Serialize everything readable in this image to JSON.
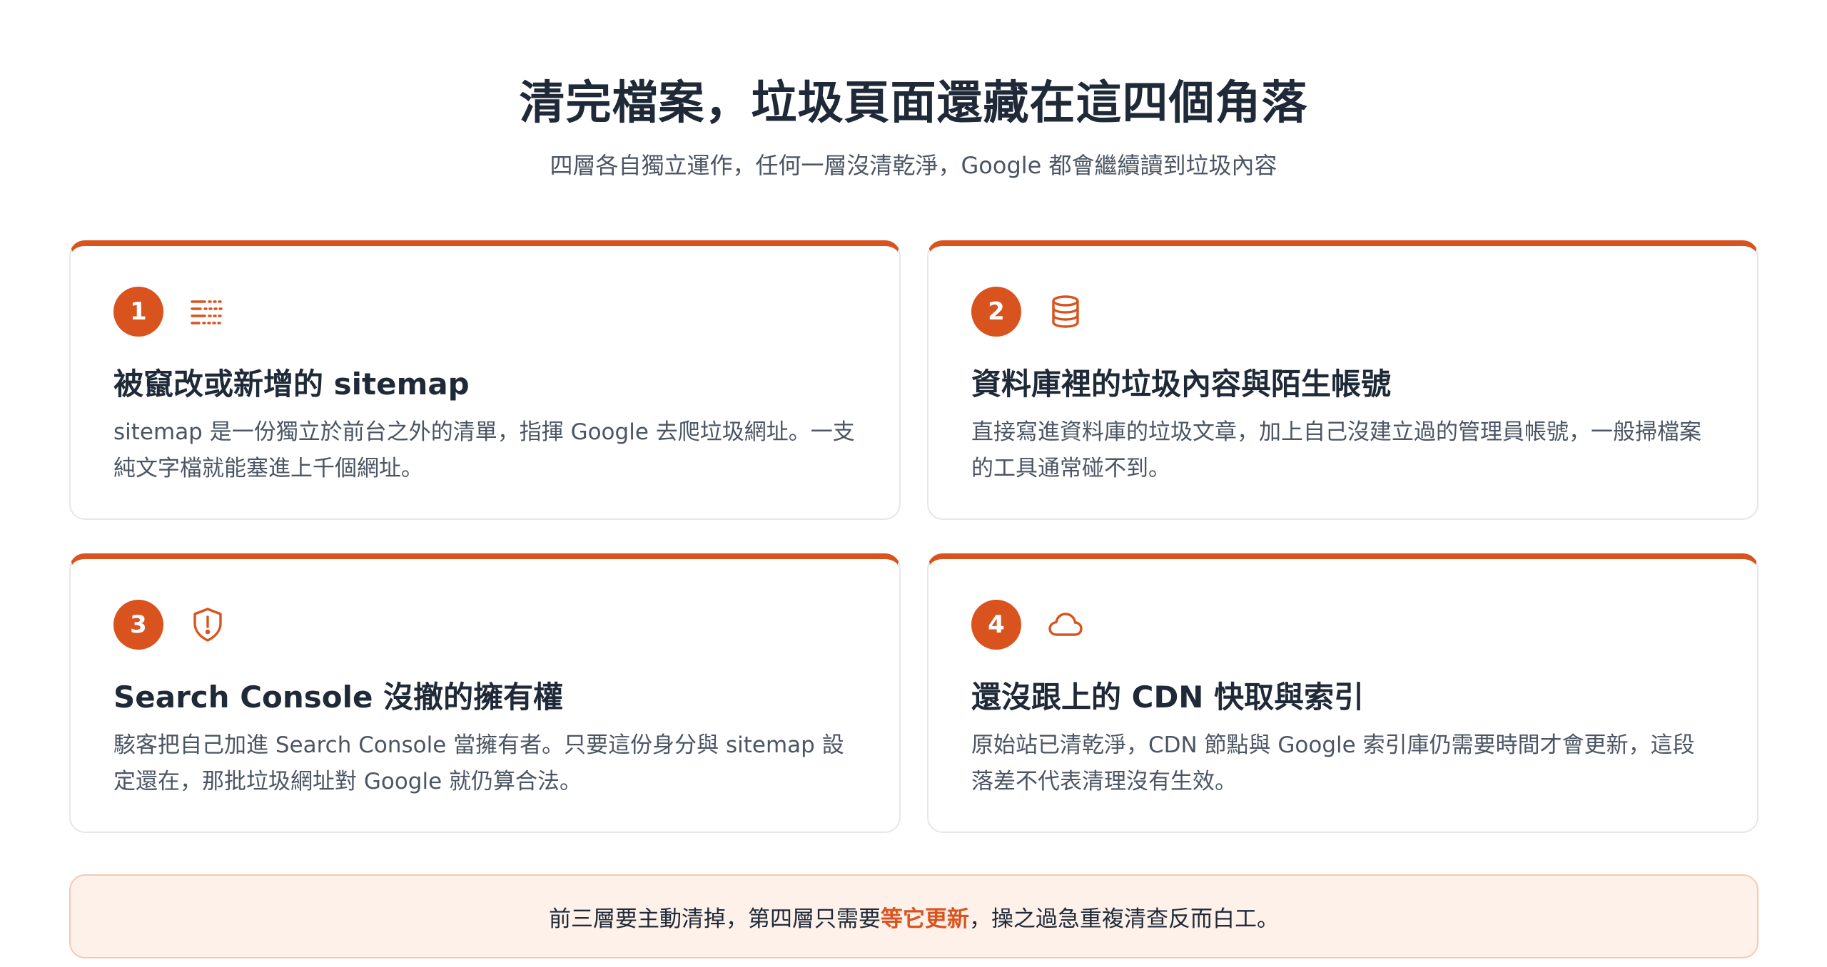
{
  "header": {
    "title": "清完檔案，垃圾頁面還藏在這四個角落",
    "subtitle": "四層各自獨立運作，任何一層沒清乾淨，Google 都會繼續讀到垃圾內容"
  },
  "cards": [
    {
      "number": "1",
      "icon": "list-lines-icon",
      "title": "被竄改或新增的 sitemap",
      "description": "sitemap 是一份獨立於前台之外的清單，指揮 Google 去爬垃圾網址。一支純文字檔就能塞進上千個網址。"
    },
    {
      "number": "2",
      "icon": "database-icon",
      "title": "資料庫裡的垃圾內容與陌生帳號",
      "description": "直接寫進資料庫的垃圾文章，加上自己沒建立過的管理員帳號，一般掃檔案的工具通常碰不到。"
    },
    {
      "number": "3",
      "icon": "shield-alert-icon",
      "title": "Search Console 沒撤的擁有權",
      "description": "駭客把自己加進 Search Console 當擁有者。只要這份身分與 sitemap 設定還在，那批垃圾網址對 Google 就仍算合法。"
    },
    {
      "number": "4",
      "icon": "cloud-icon",
      "title": "還沒跟上的 CDN 快取與索引",
      "description": "原始站已清乾淨，CDN 節點與 Google 索引庫仍需要時間才會更新，這段落差不代表清理沒有生效。"
    }
  ],
  "banner": {
    "before": "前三層要主動清掉，第四層只需要",
    "highlight": "等它更新",
    "after": "，操之過急重複清查反而白工。"
  },
  "colors": {
    "accent": "#d9531e",
    "banner_bg": "#fdf1ea",
    "text_dark": "#1f2937",
    "text_muted": "#4b5563"
  }
}
